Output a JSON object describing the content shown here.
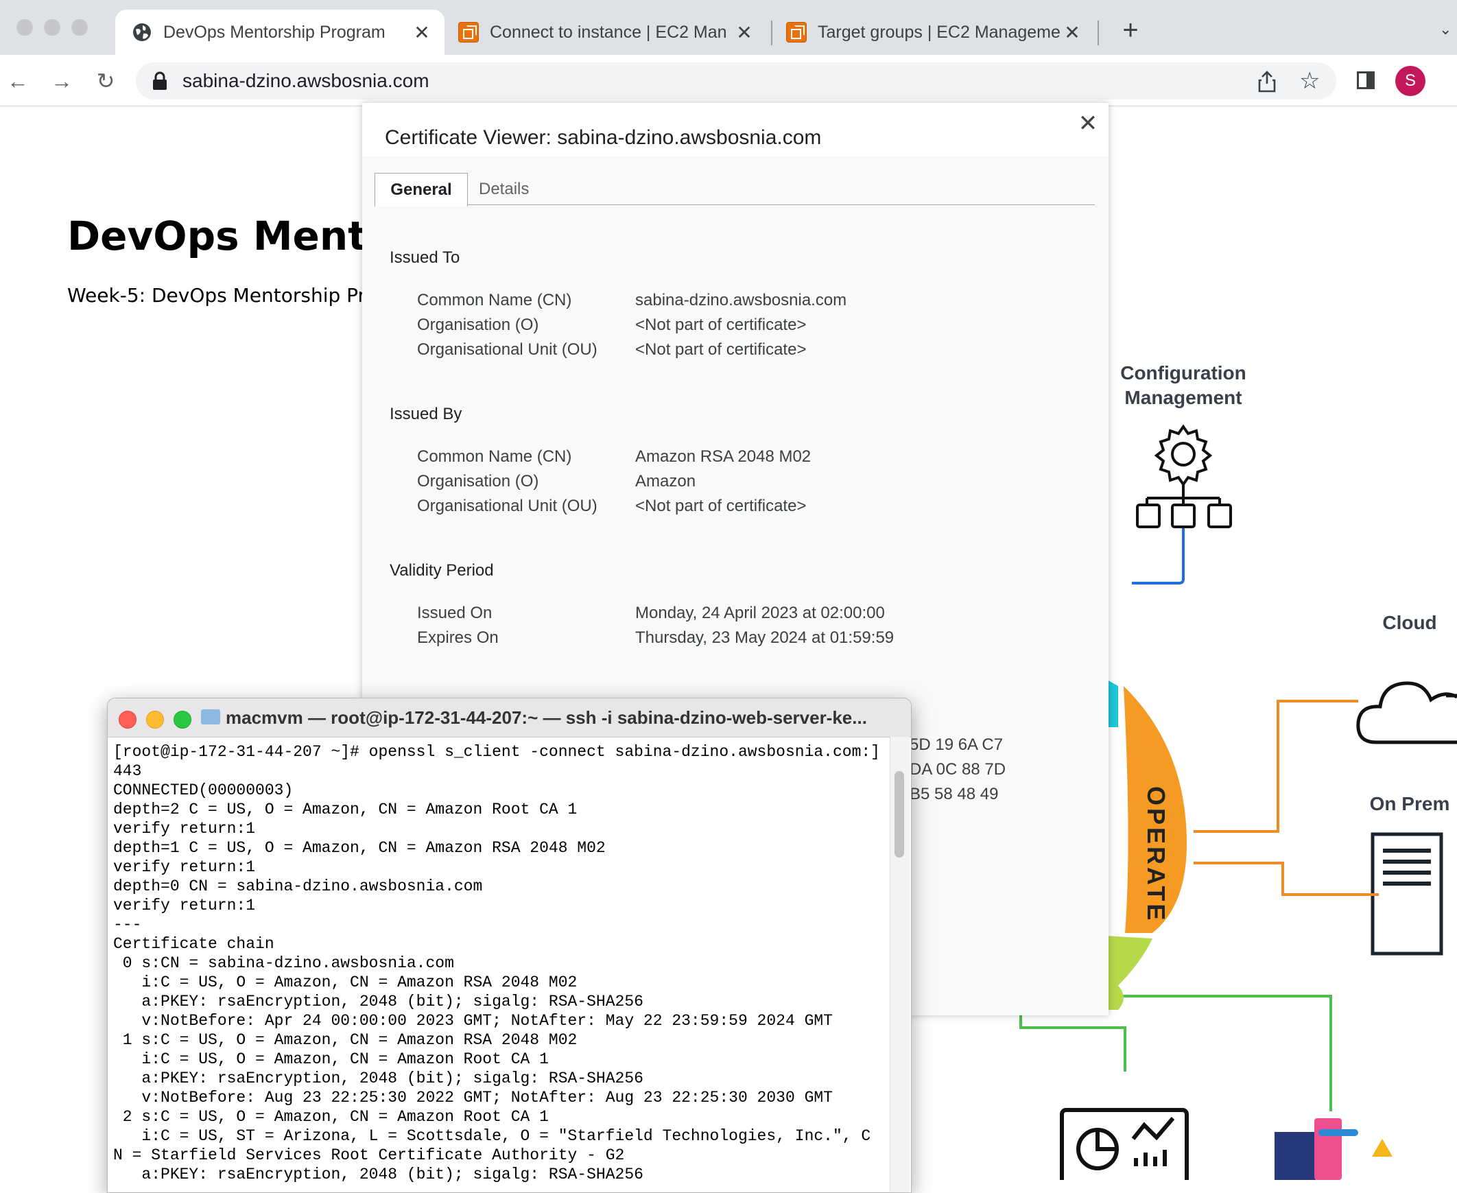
{
  "browser": {
    "tabs": [
      {
        "title": "DevOps Mentorship Program",
        "active": true,
        "icon": "globe-icon"
      },
      {
        "title": "Connect to instance | EC2 Man",
        "active": false,
        "icon": "aws-ec2-icon"
      },
      {
        "title": "Target groups | EC2 Manageme",
        "active": false,
        "icon": "aws-ec2-icon"
      }
    ],
    "url": "sabina-dzino.awsbosnia.com",
    "profile_initial": "S",
    "profile_color": "#c2185b"
  },
  "page": {
    "title": "DevOps Mentor",
    "subtitle": "Week-5: DevOps Mentorship Pr",
    "diagram": {
      "config_mgmt_line1": "Configuration",
      "config_mgmt_line2": "Management",
      "cloud": "Cloud",
      "on_prem": "On Prem",
      "operate": "OPERATE"
    }
  },
  "certificate_viewer": {
    "title": "Certificate Viewer: sabina-dzino.awsbosnia.com",
    "tabs": {
      "general": "General",
      "details": "Details"
    },
    "issued_to": {
      "heading": "Issued To",
      "cn_label": "Common Name (CN)",
      "cn": "sabina-dzino.awsbosnia.com",
      "o_label": "Organisation (O)",
      "o": "<Not part of certificate>",
      "ou_label": "Organisational Unit (OU)",
      "ou": "<Not part of certificate>"
    },
    "issued_by": {
      "heading": "Issued By",
      "cn_label": "Common Name (CN)",
      "cn": "Amazon RSA 2048 M02",
      "o_label": "Organisation (O)",
      "o": "Amazon",
      "ou_label": "Organisational Unit (OU)",
      "ou": "<Not part of certificate>"
    },
    "validity": {
      "heading": "Validity Period",
      "issued_on_label": "Issued On",
      "issued_on": "Monday, 24 April 2023 at 02:00:00",
      "expires_on_label": "Expires On",
      "expires_on": "Thursday, 23 May 2024 at 01:59:59"
    },
    "fingerprint_partial": [
      "5D 19 6A C7",
      "DA 0C 88 7D",
      "B5 58 48 49"
    ]
  },
  "terminal": {
    "title": "macmvm — root@ip-172-31-44-207:~ — ssh -i sabina-dzino-web-server-ke...",
    "lines": [
      "[root@ip-172-31-44-207 ~]# openssl s_client -connect sabina-dzino.awsbosnia.com:]",
      "443",
      "CONNECTED(00000003)",
      "depth=2 C = US, O = Amazon, CN = Amazon Root CA 1",
      "verify return:1",
      "depth=1 C = US, O = Amazon, CN = Amazon RSA 2048 M02",
      "verify return:1",
      "depth=0 CN = sabina-dzino.awsbosnia.com",
      "verify return:1",
      "---",
      "Certificate chain",
      " 0 s:CN = sabina-dzino.awsbosnia.com",
      "   i:C = US, O = Amazon, CN = Amazon RSA 2048 M02",
      "   a:PKEY: rsaEncryption, 2048 (bit); sigalg: RSA-SHA256",
      "   v:NotBefore: Apr 24 00:00:00 2023 GMT; NotAfter: May 22 23:59:59 2024 GMT",
      " 1 s:C = US, O = Amazon, CN = Amazon RSA 2048 M02",
      "   i:C = US, O = Amazon, CN = Amazon Root CA 1",
      "   a:PKEY: rsaEncryption, 2048 (bit); sigalg: RSA-SHA256",
      "   v:NotBefore: Aug 23 22:25:30 2022 GMT; NotAfter: Aug 23 22:25:30 2030 GMT",
      " 2 s:C = US, O = Amazon, CN = Amazon Root CA 1",
      "   i:C = US, ST = Arizona, L = Scottsdale, O = \"Starfield Technologies, Inc.\", C",
      "N = Starfield Services Root Certificate Authority - G2",
      "   a:PKEY: rsaEncryption, 2048 (bit); sigalg: RSA-SHA256"
    ]
  }
}
